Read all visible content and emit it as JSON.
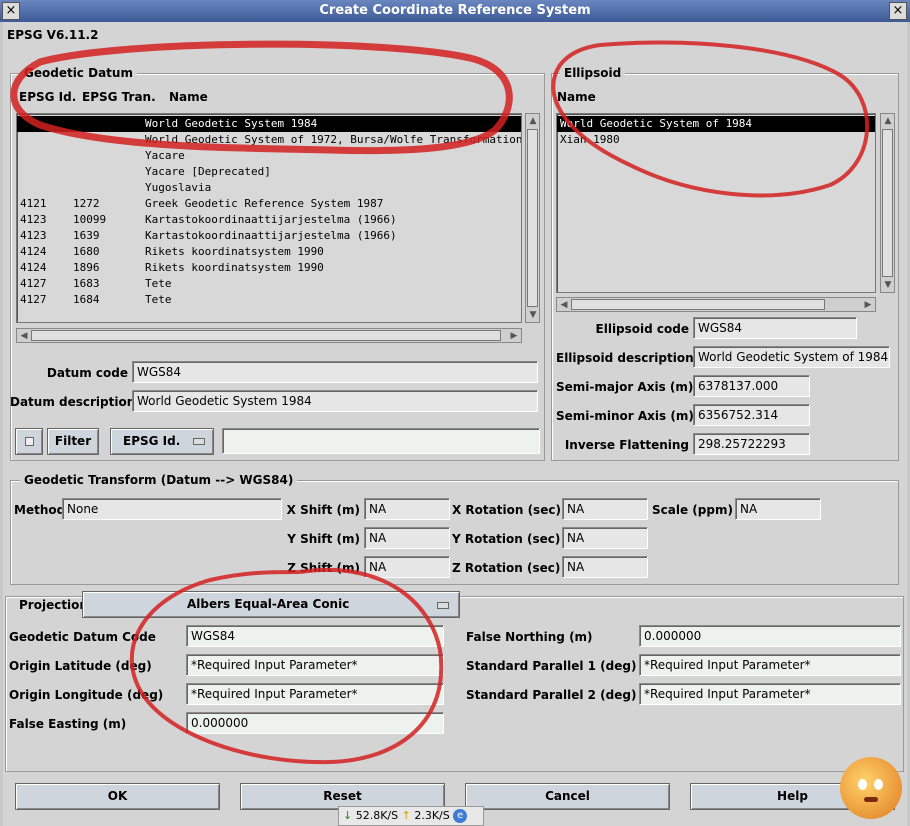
{
  "window": {
    "title": "Create Coordinate Reference System",
    "version": "EPSG V6.11.2"
  },
  "geodetic_datum": {
    "title": "Geodetic Datum",
    "columns": [
      "EPSG Id.",
      "EPSG Tran.",
      "Name"
    ],
    "rows": [
      {
        "id": "",
        "tran": "",
        "name": "World Geodetic System 1984",
        "selected": true
      },
      {
        "id": "",
        "tran": "",
        "name": "World Geodetic System of 1972, Bursa/Wolfe Transformation"
      },
      {
        "id": "",
        "tran": "",
        "name": "Yacare"
      },
      {
        "id": "",
        "tran": "",
        "name": "Yacare [Deprecated]"
      },
      {
        "id": "",
        "tran": "",
        "name": "Yugoslavia"
      },
      {
        "id": "4121",
        "tran": "1272",
        "name": "Greek Geodetic Reference System 1987"
      },
      {
        "id": "4123",
        "tran": "10099",
        "name": "Kartastokoordinaattijarjestelma (1966)"
      },
      {
        "id": "4123",
        "tran": "1639",
        "name": "Kartastokoordinaattijarjestelma (1966)"
      },
      {
        "id": "4124",
        "tran": "1680",
        "name": "Rikets koordinatsystem 1990"
      },
      {
        "id": "4124",
        "tran": "1896",
        "name": "Rikets koordinatsystem 1990"
      },
      {
        "id": "4127",
        "tran": "1683",
        "name": "Tete"
      },
      {
        "id": "4127",
        "tran": "1684",
        "name": "Tete"
      }
    ],
    "datum_code_label": "Datum code",
    "datum_code": "WGS84",
    "datum_description_label": "Datum description",
    "datum_description": "World Geodetic System 1984",
    "filter_label": "Filter",
    "filter_field_value": "EPSG Id.",
    "filter_text": ""
  },
  "ellipsoid": {
    "title": "Ellipsoid",
    "column": "Name",
    "rows": [
      {
        "name": "World Geodetic System of 1984",
        "selected": true
      },
      {
        "name": "Xian 1980"
      }
    ],
    "fields": [
      {
        "label": "Ellipsoid code",
        "value": "WGS84"
      },
      {
        "label": "Ellipsoid description",
        "value": "World Geodetic System of 1984"
      },
      {
        "label": "Semi-major Axis (m)",
        "value": "6378137.000"
      },
      {
        "label": "Semi-minor Axis (m)",
        "value": "6356752.314"
      },
      {
        "label": "Inverse Flattening",
        "value": "298.25722293"
      }
    ]
  },
  "transform": {
    "title": "Geodetic Transform (Datum --> WGS84)",
    "method_label": "Method",
    "method": "None",
    "x_shift_label": "X Shift (m)",
    "x_shift": "NA",
    "y_shift_label": "Y Shift (m)",
    "y_shift": "NA",
    "z_shift_label": "Z Shift (m)",
    "z_shift": "NA",
    "x_rot_label": "X Rotation (sec)",
    "x_rot": "NA",
    "y_rot_label": "Y Rotation (sec)",
    "y_rot": "NA",
    "z_rot_label": "Z Rotation (sec)",
    "z_rot": "NA",
    "scale_label": "Scale (ppm)",
    "scale": "NA"
  },
  "projection": {
    "label": "Projection",
    "selected": "Albers Equal-Area Conic",
    "geodetic_datum_code_label": "Geodetic Datum Code",
    "geodetic_datum_code": "WGS84",
    "origin_latitude_label": "Origin Latitude (deg)",
    "origin_latitude": "*Required Input Parameter*",
    "origin_longitude_label": "Origin Longitude (deg)",
    "origin_longitude": "*Required Input Parameter*",
    "false_easting_label": "False Easting (m)",
    "false_easting": "0.000000",
    "false_northing_label": "False Northing (m)",
    "false_northing": "0.000000",
    "std_parallel_1_label": "Standard Parallel 1 (deg)",
    "std_parallel_1": "*Required Input Parameter*",
    "std_parallel_2_label": "Standard Parallel 2 (deg)",
    "std_parallel_2": "*Required Input Parameter*"
  },
  "buttons": {
    "ok": "OK",
    "reset": "Reset",
    "cancel": "Cancel",
    "help": "Help"
  },
  "status": {
    "down": "52.8K/S",
    "up": "2.3K/S"
  },
  "colors": {
    "annotation": "#d42020",
    "titlebar": "#4f6ca8",
    "selection": "#000000"
  }
}
